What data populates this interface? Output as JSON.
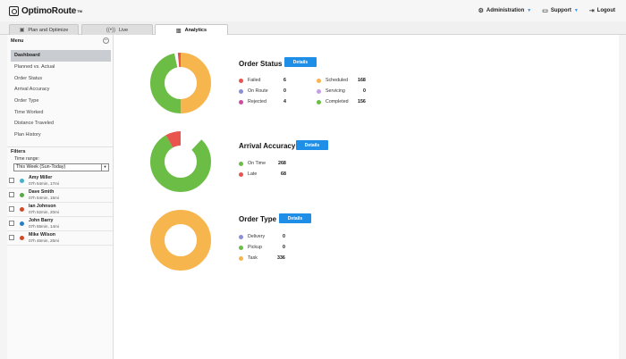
{
  "app": {
    "name": "OptimoRoute",
    "tm": "TM"
  },
  "topnav": {
    "administration": "Administration",
    "support": "Support",
    "logout": "Logout"
  },
  "tabs": [
    {
      "label": "Plan and Optimize",
      "icon": "calendar-icon"
    },
    {
      "label": "Live",
      "icon": "broadcast-icon"
    },
    {
      "label": "Analytics",
      "icon": "bar-chart-icon",
      "active": true
    }
  ],
  "sidebar": {
    "menu_title": "Menu",
    "items": [
      {
        "label": "Dashboard",
        "active": true
      },
      {
        "label": "Planned vs. Actual"
      },
      {
        "label": "Order Status"
      },
      {
        "label": "Arrival Accuracy"
      },
      {
        "label": "Order Type"
      },
      {
        "label": "Time Worked"
      },
      {
        "label": "Distance Traveled"
      },
      {
        "label": "Plan History"
      }
    ],
    "filters_title": "Filters",
    "time_range_label": "Time range:",
    "time_range_value": "This Week (Sun-Today)",
    "drivers": [
      {
        "name": "Amy Miller",
        "stats": "07h 54min, 17mi",
        "color": "#4ab0c8"
      },
      {
        "name": "Dave Smith",
        "stats": "07h 54min, 15mi",
        "color": "#5aa84a"
      },
      {
        "name": "Ian Johnson",
        "stats": "07h 52min, 20mi",
        "color": "#d04a2a"
      },
      {
        "name": "John Barry",
        "stats": "07h 55min, 14mi",
        "color": "#2a7fc0"
      },
      {
        "name": "Mike Wilson",
        "stats": "07h 46min, 26mi",
        "color": "#d04a2a"
      }
    ]
  },
  "sections": [
    {
      "title": "Order Status",
      "button": "Details",
      "chart_data": {
        "type": "pie",
        "categories": [
          "Failed",
          "On Route",
          "Rejected",
          "Scheduled",
          "Servicing",
          "Completed"
        ],
        "values": [
          6,
          0,
          4,
          168,
          0,
          156
        ]
      },
      "legend": [
        {
          "label": "Failed",
          "value": "6",
          "color": "#e8554e"
        },
        {
          "label": "On Route",
          "value": "0",
          "color": "#8a8fd6"
        },
        {
          "label": "Rejected",
          "value": "4",
          "color": "#d04aa0"
        },
        {
          "label": "Scheduled",
          "value": "168",
          "color": "#f7b54e"
        },
        {
          "label": "Servicing",
          "value": "0",
          "color": "#c79ee8"
        },
        {
          "label": "Completed",
          "value": "156",
          "color": "#6bbd45"
        }
      ]
    },
    {
      "title": "Arrival Accuracy",
      "button": "Details",
      "chart_data": {
        "type": "pie",
        "categories": [
          "On Time",
          "Late"
        ],
        "values": [
          268,
          68
        ]
      },
      "legend": [
        {
          "label": "On Time",
          "value": "268",
          "color": "#6bbd45"
        },
        {
          "label": "Late",
          "value": "68",
          "color": "#e8554e"
        }
      ]
    },
    {
      "title": "Order Type",
      "button": "Details",
      "chart_data": {
        "type": "pie",
        "categories": [
          "Delivery",
          "Pickup",
          "Task"
        ],
        "values": [
          0,
          0,
          336
        ]
      },
      "legend": [
        {
          "label": "Delivery",
          "value": "0",
          "color": "#8a8fd6"
        },
        {
          "label": "Pickup",
          "value": "0",
          "color": "#6bbd45"
        },
        {
          "label": "Task",
          "value": "336",
          "color": "#f7b54e"
        }
      ]
    }
  ]
}
